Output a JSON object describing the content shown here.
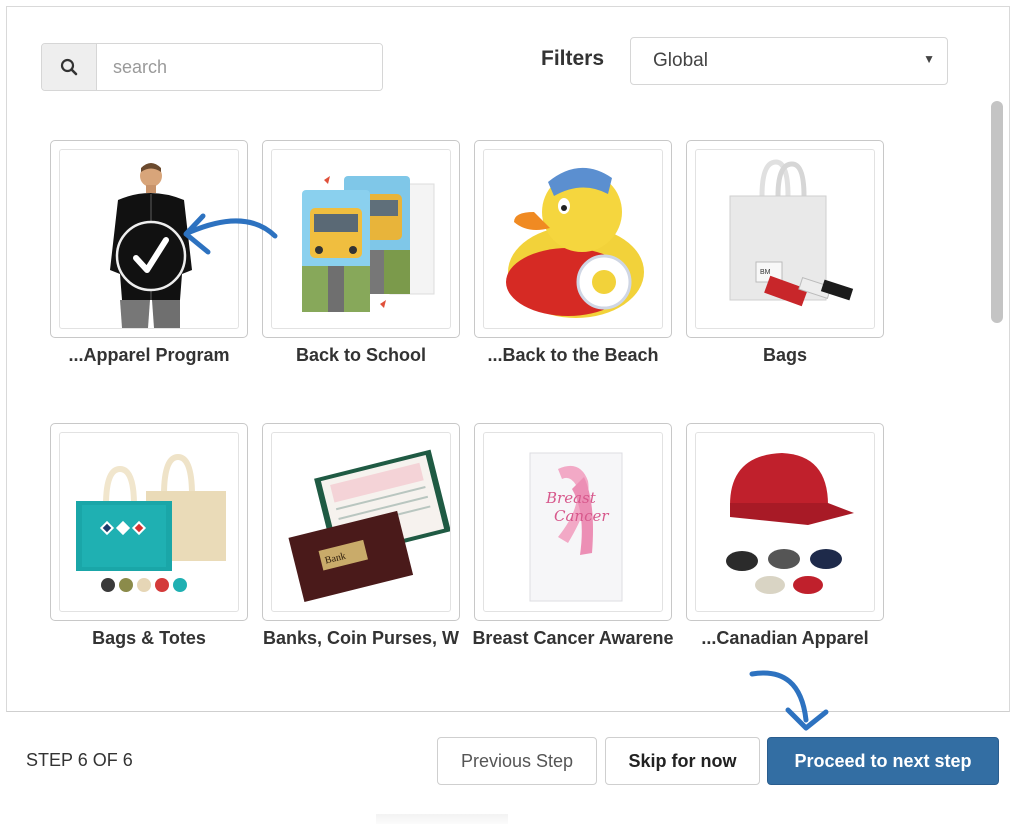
{
  "search": {
    "placeholder": "search",
    "icon": "search-icon"
  },
  "filters": {
    "label": "Filters",
    "selected": "Global",
    "caret": "▼"
  },
  "tiles": [
    {
      "label": "...Apparel Program",
      "image": "black-zip-jacket",
      "selected": true
    },
    {
      "label": "Back to School",
      "image": "school-bus-cards",
      "selected": false
    },
    {
      "label": "...Back to the Beach",
      "image": "rubber-duck",
      "selected": false
    },
    {
      "label": "Bags",
      "image": "tote-bag",
      "selected": false
    },
    {
      "label": "Bags & Totes",
      "image": "canvas-totes",
      "selected": false
    },
    {
      "label": "Banks, Coin Purses, W",
      "image": "checkbook-covers",
      "selected": false
    },
    {
      "label": "Breast Cancer Awarene",
      "image": "pink-ribbon-brochure",
      "selected": false
    },
    {
      "label": "...Canadian Apparel",
      "image": "red-cap",
      "selected": false
    }
  ],
  "footer": {
    "step": "STEP 6 OF 6",
    "previous": "Previous Step",
    "skip": "Skip for now",
    "next": "Proceed to next step"
  },
  "colors": {
    "primary": "#336ea3",
    "annotation_arrow": "#2d72c0"
  }
}
